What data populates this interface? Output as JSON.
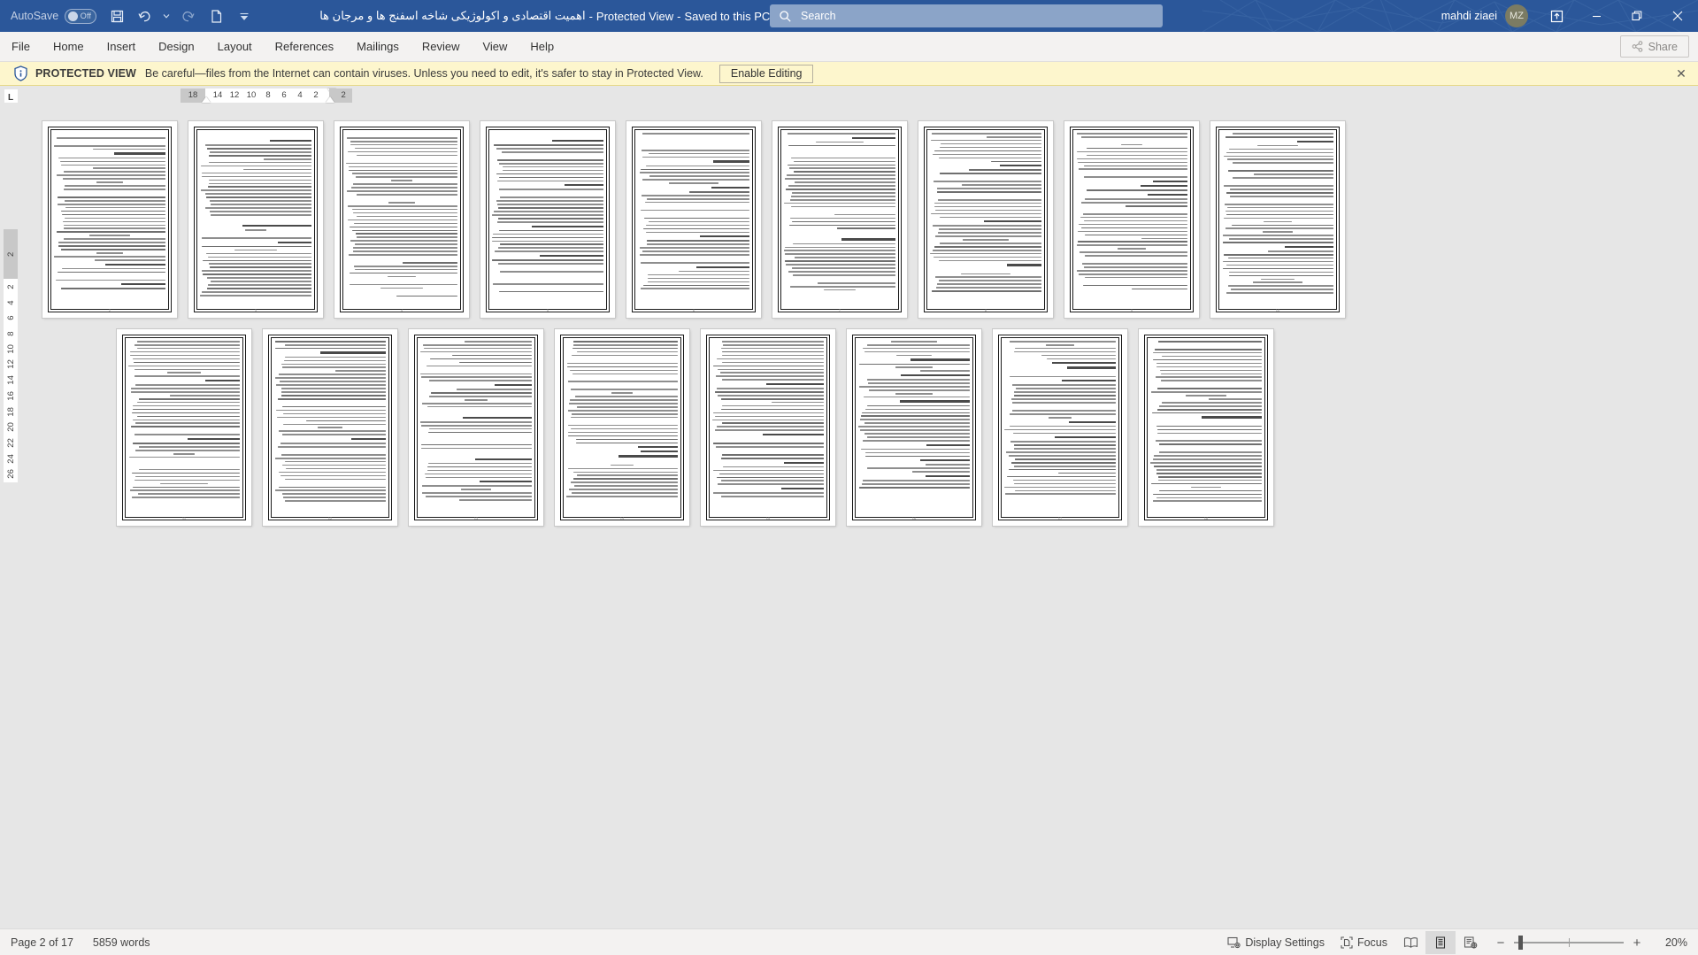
{
  "titlebar": {
    "autosave_label": "AutoSave",
    "autosave_state": "Off",
    "icons": [
      "save-icon",
      "undo-icon",
      "undo-dropdown-icon",
      "redo-icon",
      "new-blank-icon",
      "customize-qat-icon"
    ],
    "document_title": "اهميت اقتصادی و اکولوژیکی شاخه اسفنج ها و مرجان ها",
    "separator1": "-",
    "protected_view_label": "Protected View",
    "separator2": "-",
    "saved_location": "Saved to this PC",
    "caret": "▾",
    "account_name": "mahdi ziaei",
    "account_initials": "MZ",
    "min_label": "—",
    "restore_label": "❐",
    "close_label": "✕"
  },
  "search": {
    "placeholder": "Search",
    "icon": "search-icon"
  },
  "ribbon": {
    "tabs": [
      {
        "label": "File"
      },
      {
        "label": "Home"
      },
      {
        "label": "Insert"
      },
      {
        "label": "Design"
      },
      {
        "label": "Layout"
      },
      {
        "label": "References"
      },
      {
        "label": "Mailings"
      },
      {
        "label": "Review"
      },
      {
        "label": "View"
      },
      {
        "label": "Help"
      }
    ],
    "share_label": "Share"
  },
  "protected_view": {
    "icon": "shield-icon",
    "title": "PROTECTED VIEW",
    "message": "Be careful—files from the Internet can contain viruses. Unless you need to edit, it's safer to stay in Protected View.",
    "enable_label": "Enable Editing",
    "close_label": "✕"
  },
  "ruler": {
    "corner_label": "L",
    "horizontal_numbers": [
      "18",
      "14",
      "12",
      "10",
      "8",
      "6",
      "4",
      "2",
      "2"
    ],
    "vertical_numbers": [
      "2",
      "2",
      "4",
      "6",
      "8",
      "10",
      "12",
      "14",
      "16",
      "18",
      "20",
      "22",
      "24",
      "26"
    ]
  },
  "document": {
    "total_pages": 17,
    "row1_pages": [
      2,
      3,
      4,
      5,
      6,
      7,
      8,
      9,
      10
    ],
    "row2_pages": [
      11,
      12,
      13,
      14,
      15,
      16,
      17,
      18
    ]
  },
  "statusbar": {
    "page_label": "Page 2 of 17",
    "word_count": "5859 words",
    "display_settings": "Display Settings",
    "display_settings_icon": "display-settings-icon",
    "focus": "Focus",
    "focus_icon": "focus-icon",
    "view_read_icon": "read-mode-icon",
    "view_print_icon": "print-layout-icon",
    "view_web_icon": "web-layout-icon",
    "zoom_out": "−",
    "zoom_in": "+",
    "zoom_level": "20%"
  },
  "colors": {
    "titlebar": "#2b579a",
    "ribbon": "#f3f2f1",
    "protected_bar": "#fdf6cd",
    "canvas": "#e6e6e6",
    "accent": "#2b579a"
  }
}
